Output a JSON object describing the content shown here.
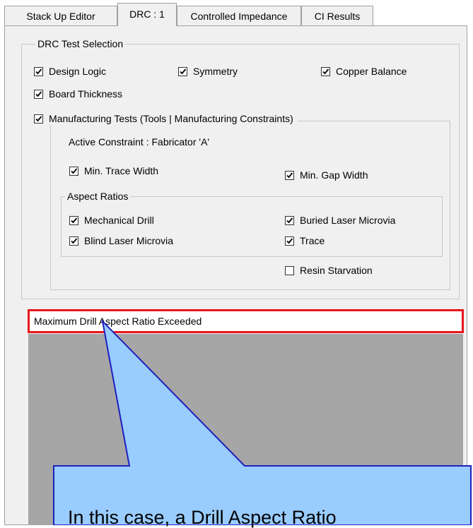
{
  "tabs": [
    {
      "label": "Stack Up Editor"
    },
    {
      "label": "DRC : 1"
    },
    {
      "label": "Controlled Impedance"
    },
    {
      "label": "CI Results"
    }
  ],
  "drc_group": {
    "legend": "DRC Test Selection",
    "design_logic": "Design Logic",
    "symmetry": "Symmetry",
    "copper_balance": "Copper Balance",
    "board_thickness": "Board Thickness",
    "manufacturing_tests": "Manufacturing Tests (Tools | Manufacturing Constraints)"
  },
  "manufacturing": {
    "active_constraint": "Active Constraint : Fabricator 'A'",
    "min_trace_width": "Min. Trace Width",
    "min_gap_width": "Min. Gap Width",
    "aspect_legend": "Aspect Ratios",
    "mechanical_drill": "Mechanical Drill",
    "buried_laser_microvia": "Buried Laser Microvia",
    "blind_laser_microvia": "Blind Laser Microvia",
    "trace": "Trace",
    "resin_starvation": "Resin Starvation"
  },
  "checks": {
    "design_logic": true,
    "symmetry": true,
    "copper_balance": true,
    "board_thickness": true,
    "manufacturing_tests": true,
    "min_trace_width": true,
    "min_gap_width": true,
    "mechanical_drill": true,
    "buried_laser_microvia": true,
    "blind_laser_microvia": true,
    "trace": true,
    "resin_starvation": false
  },
  "message": "Maximum Drill Aspect Ratio Exceeded",
  "callout_text": "In this case, a Drill Aspect Ratio",
  "colors": {
    "highlight_border": "#e8161c",
    "callout_fill": "#99ccff",
    "callout_stroke": "#1f1fbf"
  }
}
